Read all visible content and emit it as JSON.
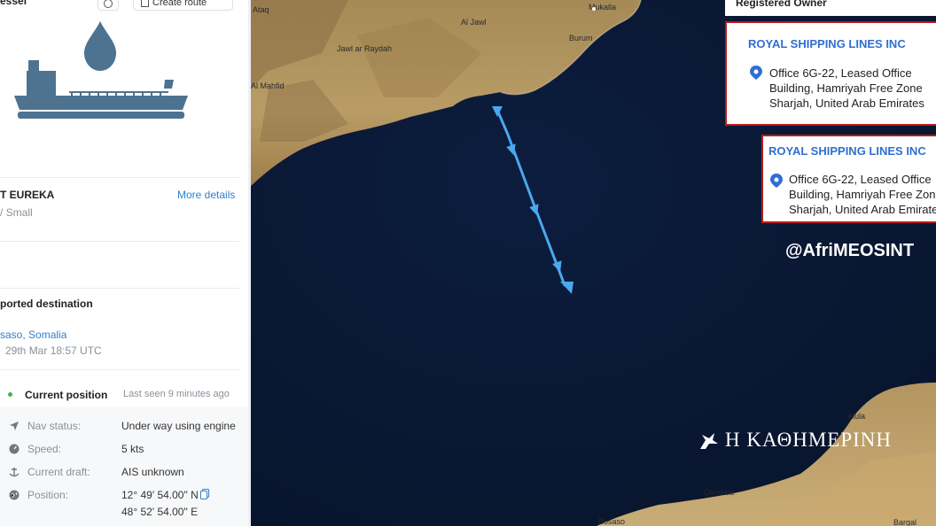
{
  "panel": {
    "title": "essel",
    "btn_create_route": "Create route",
    "vessel_name": "T EUREKA",
    "vessel_size": "/ Small",
    "more_details": "More details",
    "reported_destination_label": "ported destination",
    "destination": "saso, Somalia",
    "destination_time": "29th Mar 18:57 UTC",
    "current_position_label": "Current position",
    "last_seen": "Last seen 9 minutes ago",
    "rows": [
      {
        "label": "Nav status:",
        "value": "Under way using engine",
        "icon": "navigation-arrow-icon"
      },
      {
        "label": "Speed:",
        "value": "5 kts",
        "icon": "speed-icon"
      },
      {
        "label": "Current draft:",
        "value": "AIS unknown",
        "icon": "anchor-icon"
      },
      {
        "label": "Position:",
        "value": "12° 49' 54.00\" N",
        "value2": "48° 52' 54.00\" E",
        "icon": "globe-icon"
      }
    ]
  },
  "map": {
    "places": {
      "ataq": "Ataq",
      "mukalla": "Mukalla",
      "al_jawl": "Al Jawl",
      "jawlar": "Jawl ar Raydah",
      "burum": "Burum",
      "al_mahfid": "Al Mahfid",
      "alula": "Alula",
      "qandala": "Qandala",
      "bosaso": "Bosaso",
      "bargal": "Bargal"
    },
    "registered_owner_header": "Registered Owner",
    "owner1": {
      "name": "ROYAL SHIPPING LINES INC",
      "addr1": "Office 6G-22, Leased Office",
      "addr2": "Building, Hamriyah Free Zone",
      "addr3": "Sharjah, United Arab Emirates"
    },
    "owner2": {
      "name": "ROYAL SHIPPING LINES INC",
      "addr1": "Office 6G-22, Leased Office",
      "addr2": "Building, Hamriyah Free Zone",
      "addr3": "Sharjah, United Arab Emirates"
    },
    "watermark": "@AfriMEOSINT",
    "publisher": "Η ΚΑΘΗΜΕΡΙΝΗ",
    "colors": {
      "sea": "#0b1b3a",
      "land": "#b79a63",
      "track": "#4aa8f0",
      "box_border": "#b71c1c"
    }
  }
}
